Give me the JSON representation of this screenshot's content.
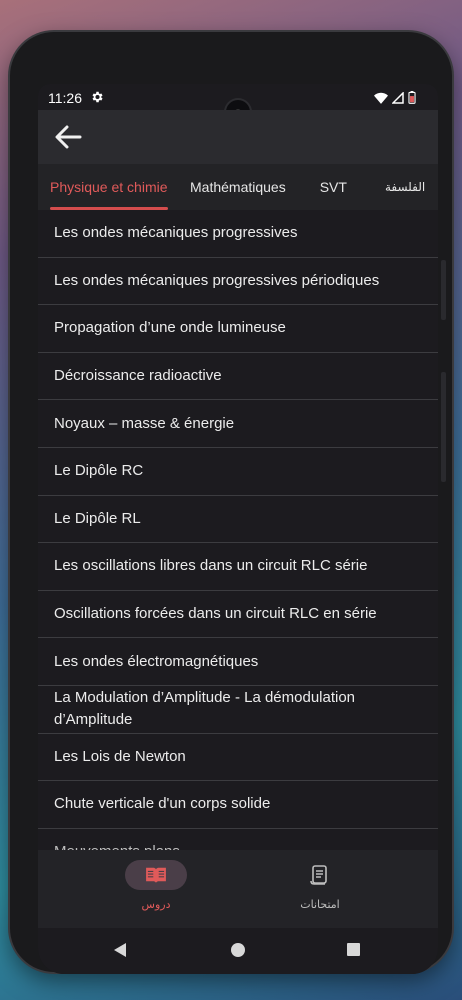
{
  "status_bar": {
    "time": "11:26",
    "icons": [
      "gear-icon",
      "wifi-icon",
      "signal-icon",
      "battery-icon"
    ]
  },
  "app_bar": {
    "back_icon": "arrow-left-icon"
  },
  "tabs": [
    {
      "label": "Physique et chimie",
      "active": true
    },
    {
      "label": "Mathématiques",
      "active": false
    },
    {
      "label": "SVT",
      "active": false
    },
    {
      "label": "الفلسفة",
      "active": false
    }
  ],
  "lessons": [
    "Les ondes mécaniques progressives",
    "Les ondes mécaniques progressives périodiques",
    "Propagation d’une onde lumineuse",
    "Décroissance radioactive",
    "Noyaux – masse & énergie",
    "Le Dipôle RC",
    "Le Dipôle RL",
    "Les oscillations libres dans un circuit RLC série",
    "Oscillations forcées dans un circuit RLC en série",
    "Les ondes électromagnétiques",
    "La Modulation d’Amplitude - La démodulation d’Amplitude",
    "Les Lois de Newton",
    "Chute verticale d'un corps solide",
    "Mouvements plans"
  ],
  "bottom_nav": [
    {
      "label": "دروس",
      "icon": "book-icon",
      "active": true
    },
    {
      "label": "امتحانات",
      "icon": "scroll-icon",
      "active": false
    }
  ],
  "colors": {
    "accent": "#e05a5a",
    "background": "#1c1b1f",
    "appbar": "#2b2b2f",
    "divider": "#3c3c40"
  }
}
